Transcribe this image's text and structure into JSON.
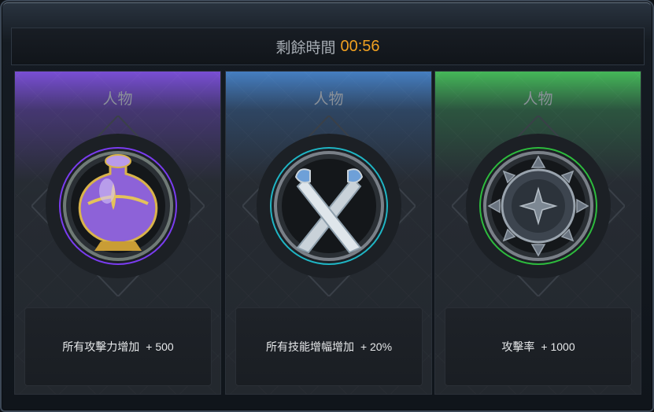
{
  "header": {
    "label": "剩餘時間",
    "timer": "00:56"
  },
  "cards": [
    {
      "category": "人物",
      "effect": "所有攻擊力增加",
      "value": "+ 500",
      "accent": "#8a4cff",
      "icon": "potion-icon"
    },
    {
      "category": "人物",
      "effect": "所有技能增幅增加",
      "value": "+ 20%",
      "accent": "#1fb5c4",
      "icon": "crossed-swords-icon"
    },
    {
      "category": "人物",
      "effect": "攻擊率",
      "value": "+ 1000",
      "accent": "#2dbb3d",
      "icon": "spiked-shield-icon"
    }
  ]
}
